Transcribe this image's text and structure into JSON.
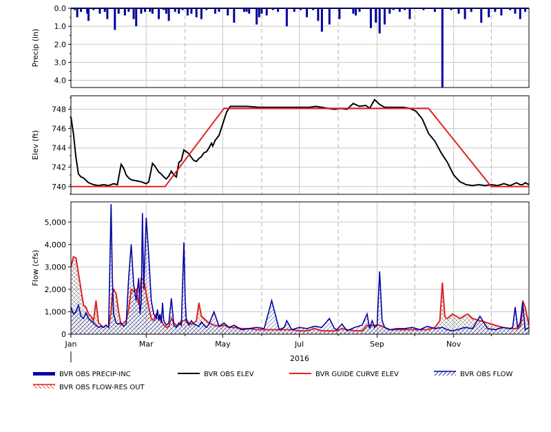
{
  "chart_data": [
    {
      "type": "bar",
      "ylabel": "Precip (in)",
      "ylim": [
        4.4,
        0
      ],
      "yticks": [
        "0.0",
        "1.0",
        "2.0",
        "3.0",
        "4.0"
      ],
      "ytick_values": [
        0,
        1,
        2,
        3,
        4
      ],
      "y_inverted": true,
      "grid": true,
      "series": [
        {
          "name": "BVR OBS PRECIP-INC",
          "color": "#0000a0",
          "x_day": [
            3,
            5,
            8,
            13,
            14,
            18,
            23,
            27,
            29,
            35,
            38,
            43,
            46,
            50,
            52,
            56,
            59,
            63,
            65,
            70,
            74,
            76,
            78,
            83,
            86,
            89,
            93,
            96,
            100,
            104,
            108,
            115,
            118,
            125,
            130,
            138,
            140,
            142,
            148,
            150,
            152,
            156,
            161,
            165,
            172,
            178,
            183,
            188,
            193,
            197,
            200,
            206,
            214,
            225,
            227,
            230,
            239,
            243,
            246,
            250,
            254,
            257,
            262,
            266,
            270,
            281,
            290,
            296,
            303,
            309,
            314,
            319,
            327,
            333,
            338,
            343,
            350,
            354,
            358,
            362
          ],
          "values": [
            0.1,
            0.5,
            0.2,
            0.3,
            0.7,
            0.1,
            0.3,
            0.2,
            0.6,
            1.2,
            0.3,
            0.4,
            0.2,
            0.6,
            1.0,
            0.3,
            0.2,
            0.2,
            0.3,
            0.6,
            0.1,
            0.3,
            0.7,
            0.2,
            0.3,
            0.1,
            0.4,
            0.3,
            0.5,
            0.6,
            0.1,
            0.3,
            0.2,
            0.4,
            0.8,
            0.2,
            0.2,
            0.3,
            0.9,
            0.5,
            0.3,
            0.4,
            0.1,
            0.2,
            1.0,
            0.2,
            0.1,
            0.5,
            0.1,
            0.7,
            1.3,
            0.9,
            0.6,
            0.3,
            0.4,
            0.2,
            1.1,
            0.8,
            1.4,
            0.9,
            0.3,
            0.1,
            0.2,
            0.1,
            0.6,
            0.1,
            0.2,
            4.4,
            0.1,
            0.3,
            0.6,
            0.2,
            0.8,
            0.5,
            0.2,
            0.4,
            0.1,
            0.3,
            0.6,
            0.2
          ]
        }
      ]
    },
    {
      "type": "line",
      "ylabel": "Elev (ft)",
      "ylim": [
        739.2,
        749.4
      ],
      "yticks": [
        "740",
        "742",
        "744",
        "746",
        "748"
      ],
      "ytick_values": [
        740,
        742,
        744,
        746,
        748
      ],
      "grid": true,
      "series": [
        {
          "name": "BVR OBS ELEV",
          "color": "#000000",
          "x_day": [
            0,
            2,
            4,
            6,
            8,
            10,
            14,
            18,
            22,
            26,
            30,
            34,
            37,
            40,
            42,
            44,
            46,
            48,
            52,
            56,
            60,
            62,
            65,
            67,
            70,
            72,
            74,
            76,
            78,
            80,
            82,
            84,
            86,
            88,
            90,
            92,
            94,
            96,
            98,
            100,
            102,
            104,
            106,
            108,
            110,
            112,
            113,
            115,
            118,
            121,
            124,
            127,
            130,
            133,
            140,
            150,
            160,
            170,
            180,
            190,
            195,
            200,
            205,
            210,
            215,
            220,
            225,
            230,
            235,
            238,
            242,
            246,
            250,
            255,
            260,
            265,
            270,
            275,
            280,
            285,
            290,
            295,
            300,
            305,
            310,
            315,
            320,
            325,
            330,
            335,
            340,
            345,
            350,
            355,
            358,
            360,
            362,
            365
          ],
          "values": [
            747.2,
            745.5,
            743,
            741.3,
            741,
            740.9,
            740.4,
            740.2,
            740.1,
            740.2,
            740.1,
            740.3,
            740.2,
            742.3,
            741.9,
            741.2,
            740.9,
            740.7,
            740.6,
            740.5,
            740.3,
            740.5,
            742.4,
            742.1,
            741.5,
            741.3,
            741.0,
            740.8,
            741.1,
            741.6,
            741.2,
            741.0,
            742.5,
            742.7,
            743.8,
            743.6,
            743.4,
            743.0,
            742.7,
            742.6,
            742.9,
            743.1,
            743.5,
            743.6,
            744.0,
            744.5,
            744.2,
            744.8,
            745.3,
            746.5,
            747.7,
            748.3,
            748.3,
            748.3,
            748.3,
            748.2,
            748.2,
            748.2,
            748.2,
            748.2,
            748.3,
            748.2,
            748.1,
            748.0,
            748.1,
            748.0,
            748.6,
            748.3,
            748.4,
            748.1,
            749.0,
            748.5,
            748.2,
            748.2,
            748.2,
            748.2,
            748.1,
            747.8,
            747.0,
            745.5,
            744.7,
            743.5,
            742.5,
            741.2,
            740.5,
            740.2,
            740.1,
            740.2,
            740.1,
            740.2,
            740.1,
            740.3,
            740.1,
            740.4,
            740.2,
            740.2,
            740.4,
            740.2
          ]
        },
        {
          "name": "BVR GUIDE CURVE ELEV",
          "color": "#e02020",
          "x_day": [
            0,
            75,
            122,
            285,
            335,
            365
          ],
          "values": [
            740,
            740,
            748.1,
            748.1,
            740,
            740
          ]
        }
      ]
    },
    {
      "type": "area",
      "ylabel": "Flow (cfs)",
      "ylim": [
        0,
        5900
      ],
      "yticks": [
        "0",
        "1,000",
        "2,000",
        "3,000",
        "4,000",
        "5,000"
      ],
      "ytick_values": [
        0,
        1000,
        2000,
        3000,
        4000,
        5000
      ],
      "grid": true,
      "xlabel": "2016",
      "x_month_labels": [
        "Jan",
        "Mar",
        "May",
        "Jul",
        "Sep",
        "Nov"
      ],
      "x_month_days": [
        0,
        60,
        121,
        182,
        244,
        305
      ],
      "x_vertical_lines": [
        91,
        152,
        213,
        274,
        335
      ],
      "series": [
        {
          "name": "BVR OBS FLOW",
          "color": "#0000a0",
          "x_day": [
            0,
            2,
            4,
            6,
            8,
            10,
            12,
            14,
            16,
            18,
            20,
            22,
            24,
            26,
            28,
            30,
            32,
            33,
            34,
            35,
            36,
            38,
            40,
            42,
            44,
            46,
            48,
            50,
            52,
            54,
            55,
            56,
            57,
            58,
            60,
            62,
            64,
            66,
            68,
            69,
            70,
            71,
            72,
            73,
            74,
            76,
            78,
            80,
            82,
            84,
            86,
            88,
            90,
            91,
            92,
            94,
            96,
            98,
            100,
            102,
            104,
            106,
            108,
            110,
            114,
            118,
            122,
            126,
            130,
            136,
            142,
            148,
            154,
            160,
            166,
            170,
            172,
            176,
            182,
            188,
            194,
            200,
            206,
            210,
            212,
            216,
            220,
            226,
            232,
            236,
            238,
            240,
            242,
            244,
            246,
            248,
            250,
            254,
            260,
            266,
            272,
            278,
            284,
            290,
            296,
            300,
            304,
            308,
            314,
            320,
            326,
            332,
            338,
            344,
            350,
            352,
            354,
            356,
            358,
            360,
            362,
            365
          ],
          "values": [
            1200,
            900,
            1000,
            1300,
            800,
            700,
            950,
            700,
            600,
            500,
            400,
            300,
            350,
            300,
            400,
            300,
            5800,
            2500,
            900,
            700,
            500,
            450,
            500,
            350,
            450,
            2500,
            4000,
            2200,
            1500,
            2500,
            900,
            1400,
            5400,
            2000,
            5200,
            3500,
            1500,
            900,
            700,
            1100,
            600,
            900,
            500,
            1400,
            600,
            400,
            500,
            1600,
            400,
            300,
            500,
            400,
            4100,
            1600,
            600,
            400,
            600,
            450,
            400,
            350,
            550,
            400,
            300,
            450,
            1000,
            350,
            500,
            300,
            400,
            200,
            250,
            300,
            250,
            1500,
            200,
            300,
            600,
            200,
            300,
            250,
            350,
            300,
            700,
            250,
            200,
            450,
            150,
            300,
            400,
            900,
            250,
            600,
            300,
            400,
            2800,
            600,
            300,
            200,
            250,
            250,
            300,
            200,
            350,
            250,
            300,
            200,
            150,
            200,
            300,
            250,
            800,
            250,
            200,
            300,
            250,
            300,
            1200,
            300,
            500,
            1400,
            200,
            300,
            500,
            300
          ]
        },
        {
          "name": "BVR OBS FLOW-RES OUT",
          "color": "#e02020",
          "x_day": [
            0,
            2,
            4,
            6,
            8,
            10,
            12,
            14,
            16,
            18,
            20,
            22,
            24,
            26,
            28,
            30,
            32,
            33,
            34,
            36,
            38,
            40,
            42,
            44,
            46,
            48,
            50,
            52,
            54,
            56,
            58,
            60,
            62,
            64,
            66,
            68,
            70,
            72,
            74,
            76,
            78,
            80,
            82,
            84,
            86,
            88,
            90,
            92,
            94,
            96,
            98,
            100,
            102,
            104,
            106,
            108,
            110,
            114,
            118,
            122,
            126,
            130,
            136,
            142,
            148,
            154,
            160,
            166,
            170,
            176,
            182,
            188,
            194,
            200,
            206,
            212,
            216,
            220,
            226,
            232,
            236,
            240,
            246,
            250,
            254,
            260,
            266,
            272,
            278,
            284,
            290,
            294,
            296,
            297,
            298,
            299,
            300,
            304,
            310,
            316,
            320,
            326,
            332,
            338,
            344,
            350,
            356,
            358,
            359,
            360,
            362,
            365
          ],
          "values": [
            3000,
            3450,
            3400,
            2700,
            2000,
            1300,
            1200,
            900,
            800,
            600,
            1500,
            500,
            400,
            300,
            400,
            300,
            1000,
            1800,
            2000,
            1800,
            1000,
            400,
            500,
            600,
            1100,
            2000,
            1900,
            2000,
            1300,
            2500,
            2400,
            1800,
            1200,
            700,
            600,
            900,
            800,
            600,
            400,
            300,
            350,
            700,
            500,
            400,
            400,
            600,
            600,
            650,
            500,
            450,
            500,
            600,
            1400,
            800,
            700,
            600,
            500,
            400,
            350,
            400,
            300,
            300,
            250,
            250,
            200,
            200,
            200,
            200,
            200,
            200,
            150,
            150,
            250,
            150,
            150,
            150,
            250,
            200,
            150,
            150,
            400,
            400,
            400,
            300,
            200,
            200,
            200,
            200,
            200,
            200,
            300,
            600,
            2300,
            1500,
            800,
            700,
            700,
            900,
            700,
            900,
            700,
            600,
            500,
            400,
            300,
            250,
            250,
            350,
            600,
            1500,
            1200,
            400,
            300,
            300
          ]
        }
      ]
    }
  ],
  "legend": [
    {
      "label": "BVR OBS PRECIP-INC",
      "color": "#0000a0",
      "style": "thick"
    },
    {
      "label": "BVR OBS ELEV",
      "color": "#000000",
      "style": "line"
    },
    {
      "label": "BVR GUIDE CURVE ELEV",
      "color": "#e02020",
      "style": "line"
    },
    {
      "label": "BVR OBS FLOW",
      "color": "#0000a0",
      "style": "hatch"
    },
    {
      "label": "BVR OBS FLOW-RES OUT",
      "color": "#e02020",
      "style": "hatch"
    }
  ]
}
